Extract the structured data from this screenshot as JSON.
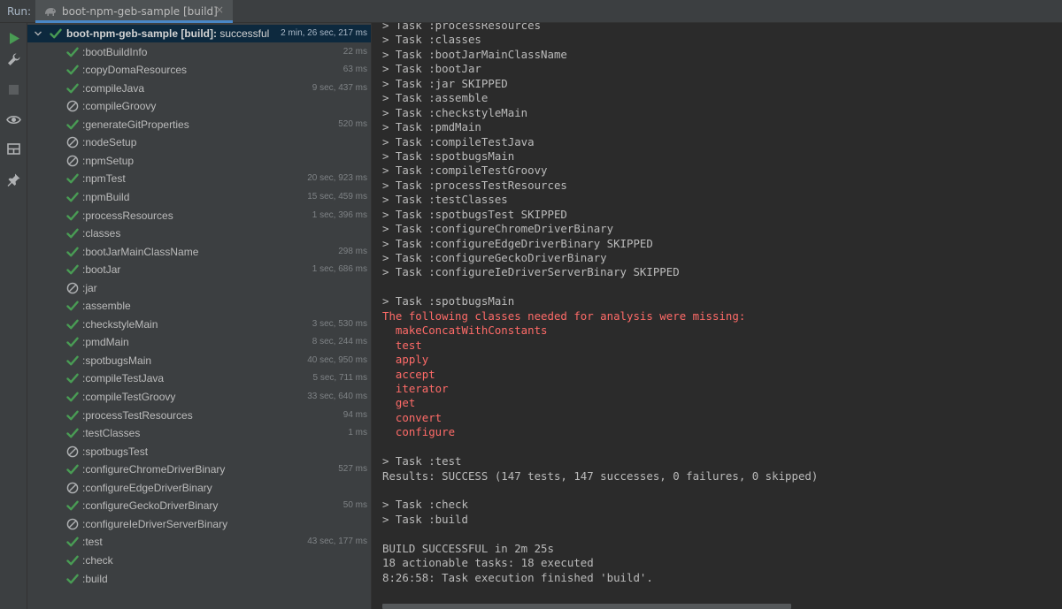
{
  "header": {
    "run_label": "Run:",
    "tab_label": "boot-npm-geb-sample [build]",
    "tab_close": "×",
    "tab_icon": "gradle-elephant-icon"
  },
  "toolbar": {
    "tools": [
      {
        "name": "run-icon",
        "color": "#499c54"
      },
      {
        "name": "wrench-icon",
        "color": "#afb1b3"
      },
      {
        "name": "stop-icon",
        "color": "#5a5d5f"
      },
      {
        "name": "eye-icon",
        "color": "#afb1b3"
      },
      {
        "name": "layout-icon",
        "color": "#afb1b3"
      },
      {
        "name": "pin-icon",
        "color": "#afb1b3"
      }
    ]
  },
  "tree": {
    "root": {
      "label": "boot-npm-geb-sample [build]:",
      "status_text": " successful",
      "time": "2 min, 26 sec, 217 ms",
      "status": "success"
    },
    "tasks": [
      {
        "label": ":bootBuildInfo",
        "time": "22 ms",
        "status": "success"
      },
      {
        "label": ":copyDomaResources",
        "time": "63 ms",
        "status": "success"
      },
      {
        "label": ":compileJava",
        "time": "9 sec, 437 ms",
        "status": "success"
      },
      {
        "label": ":compileGroovy",
        "time": "",
        "status": "skipped"
      },
      {
        "label": ":generateGitProperties",
        "time": "520 ms",
        "status": "success"
      },
      {
        "label": ":nodeSetup",
        "time": "",
        "status": "skipped"
      },
      {
        "label": ":npmSetup",
        "time": "",
        "status": "skipped"
      },
      {
        "label": ":npmTest",
        "time": "20 sec, 923 ms",
        "status": "success"
      },
      {
        "label": ":npmBuild",
        "time": "15 sec, 459 ms",
        "status": "success"
      },
      {
        "label": ":processResources",
        "time": "1 sec, 396 ms",
        "status": "success"
      },
      {
        "label": ":classes",
        "time": "",
        "status": "success"
      },
      {
        "label": ":bootJarMainClassName",
        "time": "298 ms",
        "status": "success"
      },
      {
        "label": ":bootJar",
        "time": "1 sec, 686 ms",
        "status": "success"
      },
      {
        "label": ":jar",
        "time": "",
        "status": "skipped"
      },
      {
        "label": ":assemble",
        "time": "",
        "status": "success"
      },
      {
        "label": ":checkstyleMain",
        "time": "3 sec, 530 ms",
        "status": "success"
      },
      {
        "label": ":pmdMain",
        "time": "8 sec, 244 ms",
        "status": "success"
      },
      {
        "label": ":spotbugsMain",
        "time": "40 sec, 950 ms",
        "status": "success"
      },
      {
        "label": ":compileTestJava",
        "time": "5 sec, 711 ms",
        "status": "success"
      },
      {
        "label": ":compileTestGroovy",
        "time": "33 sec, 640 ms",
        "status": "success"
      },
      {
        "label": ":processTestResources",
        "time": "94 ms",
        "status": "success"
      },
      {
        "label": ":testClasses",
        "time": "1 ms",
        "status": "success"
      },
      {
        "label": ":spotbugsTest",
        "time": "",
        "status": "skipped"
      },
      {
        "label": ":configureChromeDriverBinary",
        "time": "527 ms",
        "status": "success"
      },
      {
        "label": ":configureEdgeDriverBinary",
        "time": "",
        "status": "skipped"
      },
      {
        "label": ":configureGeckoDriverBinary",
        "time": "50 ms",
        "status": "success"
      },
      {
        "label": ":configureIeDriverServerBinary",
        "time": "",
        "status": "skipped"
      },
      {
        "label": ":test",
        "time": "43 sec, 177 ms",
        "status": "success"
      },
      {
        "label": ":check",
        "time": "",
        "status": "success"
      },
      {
        "label": ":build",
        "time": "",
        "status": "success"
      }
    ]
  },
  "console": {
    "lines": [
      {
        "text": "> Task :processResources",
        "kind": "normal"
      },
      {
        "text": "> Task :classes",
        "kind": "normal"
      },
      {
        "text": "> Task :bootJarMainClassName",
        "kind": "normal"
      },
      {
        "text": "> Task :bootJar",
        "kind": "normal"
      },
      {
        "text": "> Task :jar SKIPPED",
        "kind": "normal"
      },
      {
        "text": "> Task :assemble",
        "kind": "normal"
      },
      {
        "text": "> Task :checkstyleMain",
        "kind": "normal"
      },
      {
        "text": "> Task :pmdMain",
        "kind": "normal"
      },
      {
        "text": "> Task :compileTestJava",
        "kind": "normal"
      },
      {
        "text": "> Task :spotbugsMain",
        "kind": "normal"
      },
      {
        "text": "> Task :compileTestGroovy",
        "kind": "normal"
      },
      {
        "text": "> Task :processTestResources",
        "kind": "normal"
      },
      {
        "text": "> Task :testClasses",
        "kind": "normal"
      },
      {
        "text": "> Task :spotbugsTest SKIPPED",
        "kind": "normal"
      },
      {
        "text": "> Task :configureChromeDriverBinary",
        "kind": "normal"
      },
      {
        "text": "> Task :configureEdgeDriverBinary SKIPPED",
        "kind": "normal"
      },
      {
        "text": "> Task :configureGeckoDriverBinary",
        "kind": "normal"
      },
      {
        "text": "> Task :configureIeDriverServerBinary SKIPPED",
        "kind": "normal"
      },
      {
        "text": "",
        "kind": "normal"
      },
      {
        "text": "> Task :spotbugsMain",
        "kind": "normal"
      },
      {
        "text": "The following classes needed for analysis were missing:",
        "kind": "error"
      },
      {
        "text": "  makeConcatWithConstants",
        "kind": "error"
      },
      {
        "text": "  test",
        "kind": "error"
      },
      {
        "text": "  apply",
        "kind": "error"
      },
      {
        "text": "  accept",
        "kind": "error"
      },
      {
        "text": "  iterator",
        "kind": "error"
      },
      {
        "text": "  get",
        "kind": "error"
      },
      {
        "text": "  convert",
        "kind": "error"
      },
      {
        "text": "  configure",
        "kind": "error"
      },
      {
        "text": "",
        "kind": "normal"
      },
      {
        "text": "> Task :test",
        "kind": "normal"
      },
      {
        "text": "Results: SUCCESS (147 tests, 147 successes, 0 failures, 0 skipped)",
        "kind": "normal"
      },
      {
        "text": "",
        "kind": "normal"
      },
      {
        "text": "> Task :check",
        "kind": "normal"
      },
      {
        "text": "> Task :build",
        "kind": "normal"
      },
      {
        "text": "",
        "kind": "normal"
      },
      {
        "text": "BUILD SUCCESSFUL in 2m 25s",
        "kind": "normal"
      },
      {
        "text": "18 actionable tasks: 18 executed",
        "kind": "normal"
      },
      {
        "text": "8:26:58: Task execution finished 'build'.",
        "kind": "normal"
      }
    ]
  },
  "colors": {
    "success": "#499c54",
    "skipped": "#afb1b3",
    "error": "#ff6b68",
    "selection": "#0d293e"
  }
}
